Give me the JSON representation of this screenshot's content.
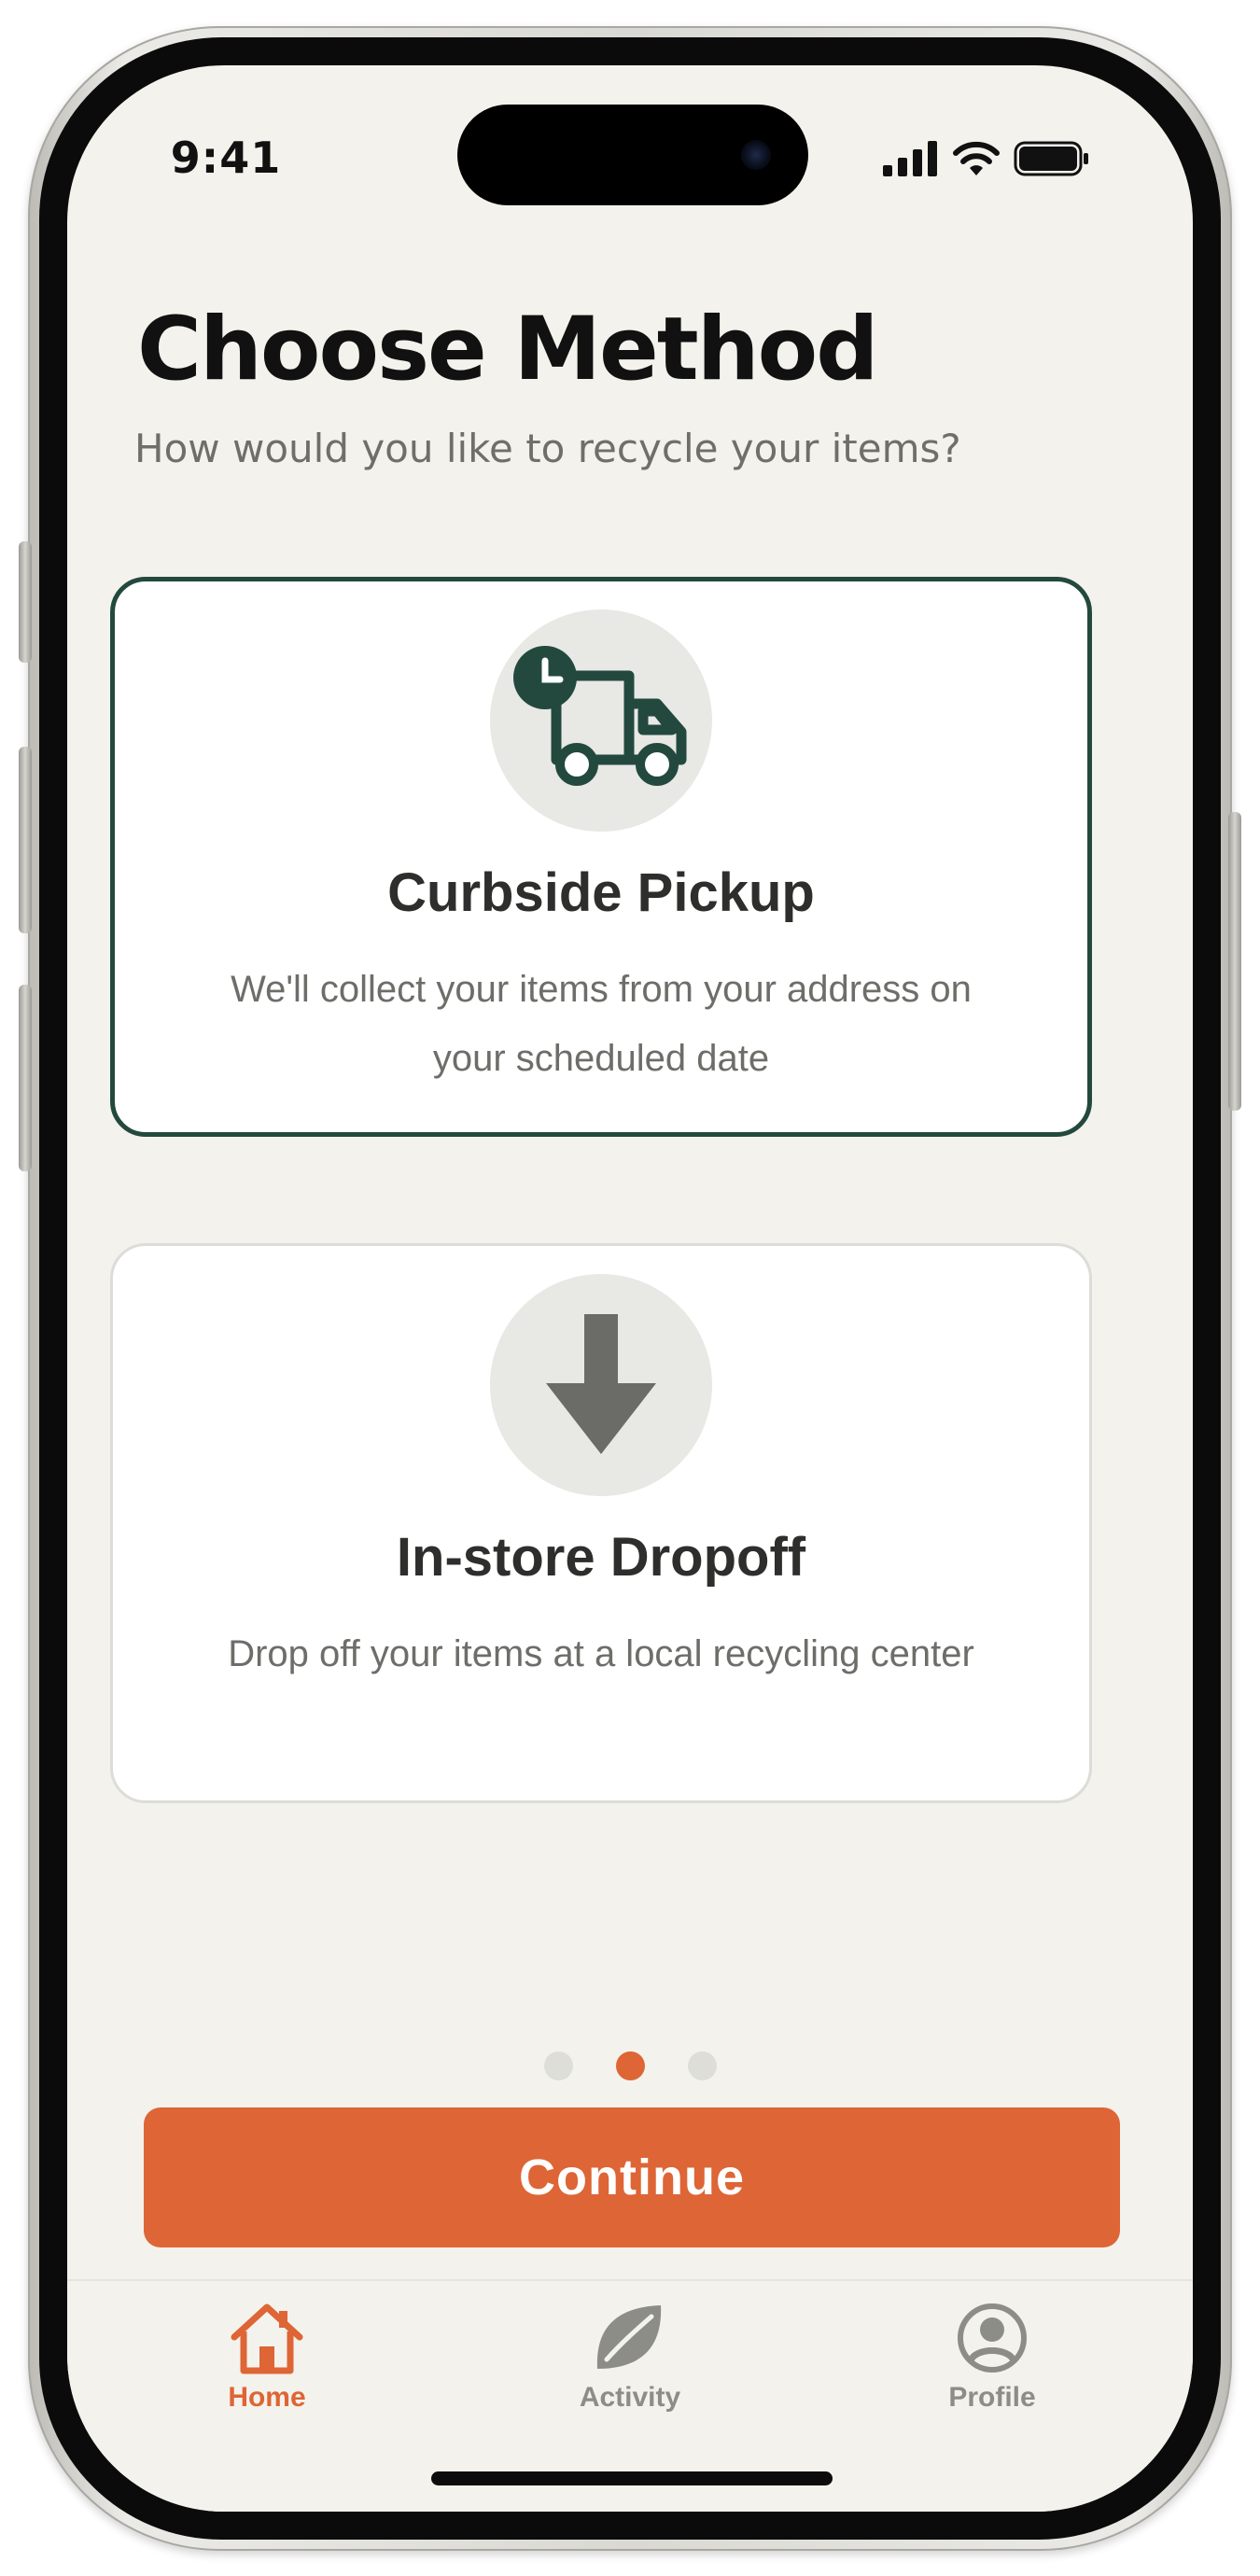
{
  "status_bar": {
    "time": "9:41",
    "icons": [
      "cellular-signal-icon",
      "wifi-icon",
      "battery-icon"
    ]
  },
  "header": {
    "title": "Choose Method",
    "subtitle": "How would you like to recycle your items?"
  },
  "options": [
    {
      "title": "Curbside Pickup",
      "description": "We'll collect your items from your address on your scheduled date",
      "icon": "delivery-truck-clock-icon",
      "selected": true
    },
    {
      "title": "In-store Dropoff",
      "description": "Drop off your items at a local recycling center",
      "icon": "arrow-down-icon",
      "selected": false
    }
  ],
  "pagination": {
    "total": 3,
    "current": 2
  },
  "continue_button": {
    "label": "Continue"
  },
  "tab_bar": {
    "items": [
      {
        "label": "Home",
        "icon": "home-icon",
        "active": true
      },
      {
        "label": "Activity",
        "icon": "leaf-icon",
        "active": false
      },
      {
        "label": "Profile",
        "icon": "user-circle-icon",
        "active": false
      }
    ]
  },
  "colors": {
    "background": "#f4f2ec",
    "accent": "#de6535",
    "selected_border": "#23493f",
    "icon_dark": "#23493f",
    "icon_muted": "#6b6b68",
    "tab_inactive": "#8d8d88"
  }
}
